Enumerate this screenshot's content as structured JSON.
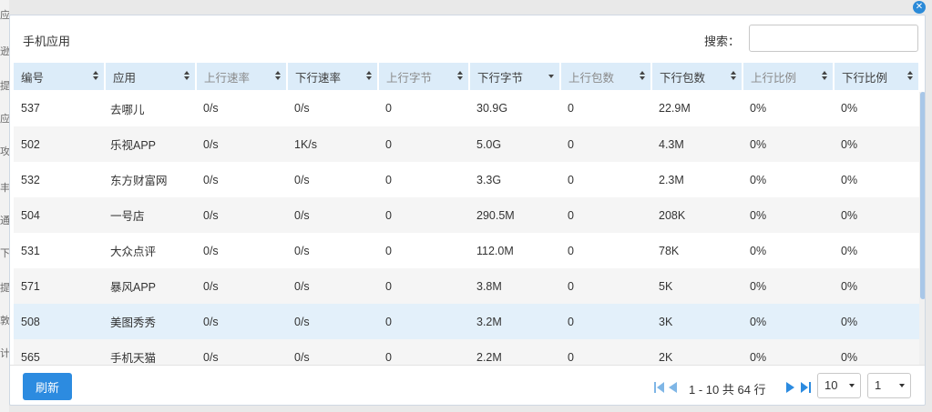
{
  "background_strip": [
    "应",
    "逊",
    "提",
    "应",
    "攻",
    "丰",
    "通",
    "下",
    "提",
    "敦",
    "计"
  ],
  "panel": {
    "title": "手机应用",
    "search_label": "搜索：",
    "search_value": "",
    "close_icon": "close-icon"
  },
  "columns": [
    {
      "label": "编号",
      "sort": "both",
      "active": true
    },
    {
      "label": "应用",
      "sort": "both",
      "active": true
    },
    {
      "label": "上行速率",
      "sort": "both",
      "active": false
    },
    {
      "label": "下行速率",
      "sort": "both",
      "active": true
    },
    {
      "label": "上行字节",
      "sort": "both",
      "active": false
    },
    {
      "label": "下行字节",
      "sort": "desc",
      "active": true
    },
    {
      "label": "上行包数",
      "sort": "both",
      "active": false
    },
    {
      "label": "下行包数",
      "sort": "both",
      "active": true
    },
    {
      "label": "上行比例",
      "sort": "both",
      "active": false
    },
    {
      "label": "下行比例",
      "sort": "both",
      "active": true
    }
  ],
  "rows": [
    {
      "cells": [
        "537",
        "去哪儿",
        "0/s",
        "0/s",
        "0",
        "30.9G",
        "0",
        "22.9M",
        "0%",
        "0%"
      ],
      "selected": false
    },
    {
      "cells": [
        "502",
        "乐视APP",
        "0/s",
        "1K/s",
        "0",
        "5.0G",
        "0",
        "4.3M",
        "0%",
        "0%"
      ],
      "selected": false
    },
    {
      "cells": [
        "532",
        "东方财富网",
        "0/s",
        "0/s",
        "0",
        "3.3G",
        "0",
        "2.3M",
        "0%",
        "0%"
      ],
      "selected": false
    },
    {
      "cells": [
        "504",
        "一号店",
        "0/s",
        "0/s",
        "0",
        "290.5M",
        "0",
        "208K",
        "0%",
        "0%"
      ],
      "selected": false
    },
    {
      "cells": [
        "531",
        "大众点评",
        "0/s",
        "0/s",
        "0",
        "112.0M",
        "0",
        "78K",
        "0%",
        "0%"
      ],
      "selected": false
    },
    {
      "cells": [
        "571",
        "暴风APP",
        "0/s",
        "0/s",
        "0",
        "3.8M",
        "0",
        "5K",
        "0%",
        "0%"
      ],
      "selected": false
    },
    {
      "cells": [
        "508",
        "美图秀秀",
        "0/s",
        "0/s",
        "0",
        "3.2M",
        "0",
        "3K",
        "0%",
        "0%"
      ],
      "selected": true
    },
    {
      "cells": [
        "565",
        "手机天猫",
        "0/s",
        "0/s",
        "0",
        "2.2M",
        "0",
        "2K",
        "0%",
        "0%"
      ],
      "selected": false
    }
  ],
  "footer": {
    "refresh_label": "刷新",
    "page_info": "1 - 10 共 64 行",
    "page_size": "10",
    "page_number": "1"
  },
  "colors": {
    "header_bg": "#dcecf9",
    "accent": "#2c8be0",
    "selected_row": "#e3f0fa"
  }
}
